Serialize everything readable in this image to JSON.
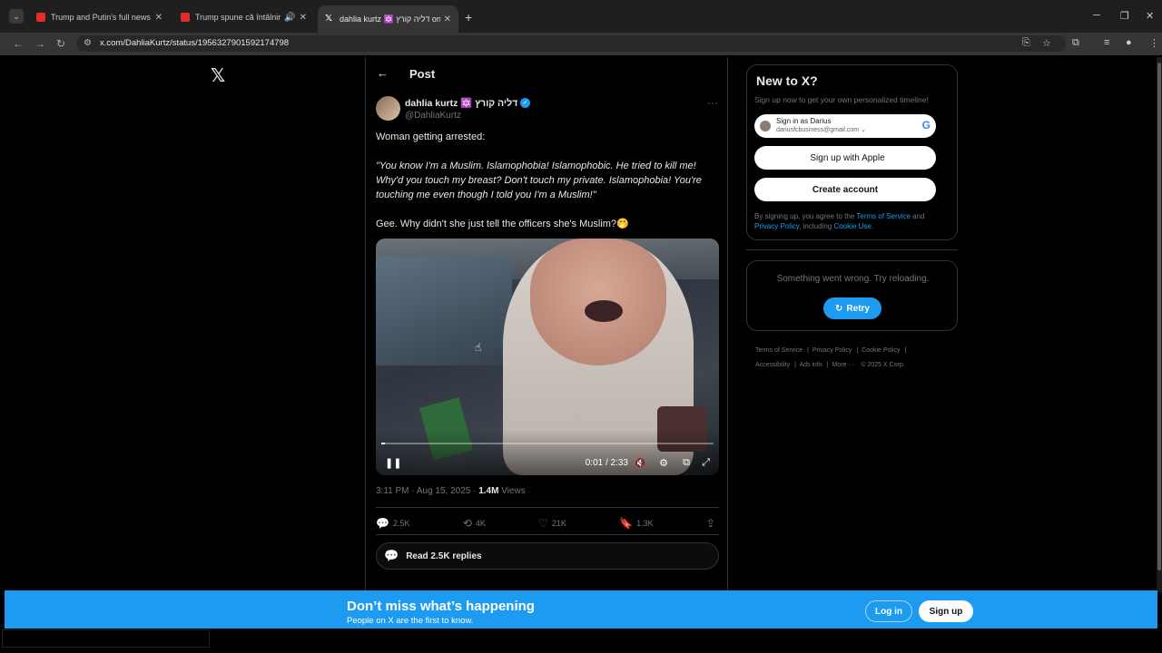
{
  "browser": {
    "tabs": [
      {
        "title": "Trump and Putin's full news con",
        "favicon": "youtube"
      },
      {
        "title": "Trump spune că întâlnirea cu",
        "favicon": "youtube",
        "audio": true
      },
      {
        "title": "dahlia kurtz 🔯 דליה קורץ on X",
        "favicon": "x",
        "active": true
      }
    ],
    "url": "x.com/DahliaKurtz/status/1956327901592174798"
  },
  "header": {
    "title": "Post"
  },
  "post": {
    "author_name": "dahlia kurtz 🔯 דליה קורץ",
    "handle": "@DahliaKurtz",
    "text_1": "Woman getting arrested:",
    "text_2": "\"You know I'm a Muslim. Islamophobia! Islamophobic. He tried to kill me! Why'd you touch my breast? Don't touch my private. Islamophobia! You're touching me even though I told you I'm a Muslim!\"",
    "text_3": "Gee. Why didn't she just tell the officers she's Muslim?🤭",
    "video": {
      "time": "0:01 / 2:33",
      "progress": 0.01
    },
    "timestamp": "3:11 PM · Aug 15, 2025 · ",
    "views_count": "1.4M",
    "views_label": " Views",
    "replies": "2.5K",
    "reposts": "4K",
    "likes": "21K",
    "bookmarks": "1.3K",
    "read_replies": "Read 2.5K replies"
  },
  "sidebar": {
    "new_title": "New to X?",
    "new_sub": "Sign up now to get your own personalized timeline!",
    "google_line1": "Sign in as Darius",
    "google_line2": "dariusfcbusiness@gmail.com",
    "apple_label": "Sign up with Apple",
    "create_label": "Create account",
    "legal_prefix": "By signing up, you agree to the ",
    "legal_tos": "Terms of Service",
    "legal_and": " and ",
    "legal_privacy": "Privacy Policy",
    "legal_including": ", including ",
    "legal_cookie": "Cookie Use.",
    "error_msg": "Something went wrong. Try reloading.",
    "retry_label": "Retry",
    "footer": [
      "Terms of Service",
      "Privacy Policy",
      "Cookie Policy",
      "Accessibility",
      "Ads info",
      "More ···",
      "© 2025 X Corp."
    ]
  },
  "bottom_bar": {
    "title": "Don’t miss what’s happening",
    "subtitle": "People on X are the first to know.",
    "login": "Log in",
    "signup": "Sign up"
  },
  "colors": {
    "accent": "#1d9bf0",
    "background": "#000000",
    "muted": "#71767b"
  }
}
